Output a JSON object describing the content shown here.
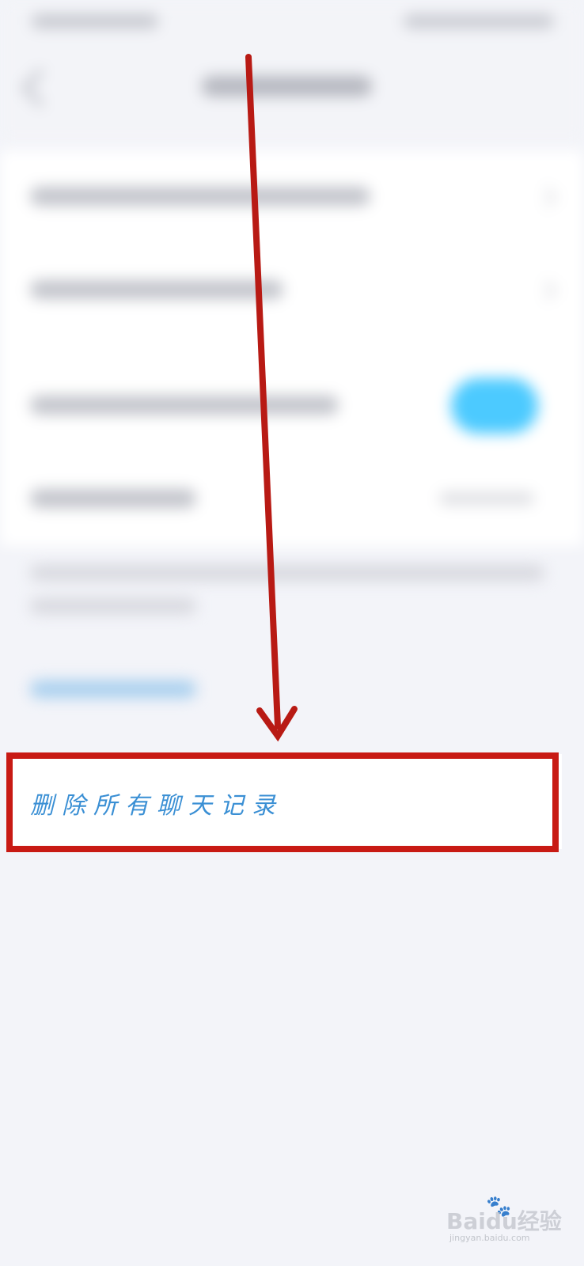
{
  "delete_row": {
    "label": "删除所有聊天记录"
  },
  "annotation": {
    "arrow_color": "#c81a14",
    "highlight_color": "#c81a14"
  },
  "colors": {
    "link_blue": "#3a8fd4",
    "toggle_on": "#4ccaff",
    "page_background": "#f3f4f9"
  },
  "watermark": {
    "brand": "Baidu经验",
    "domain": "jingyan.baidu.com"
  }
}
